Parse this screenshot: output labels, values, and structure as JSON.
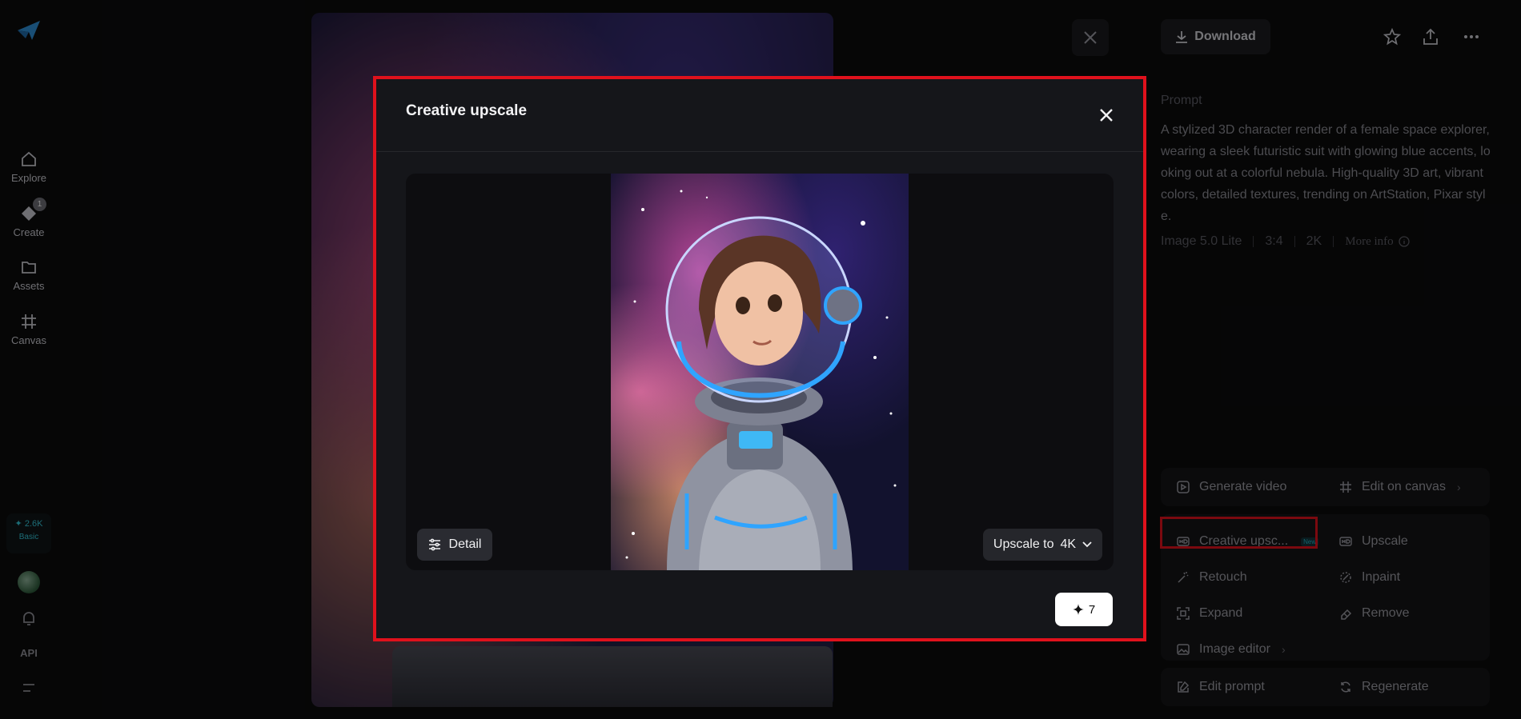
{
  "sidebar": {
    "items": [
      {
        "label": "Explore",
        "icon": "home-icon"
      },
      {
        "label": "Create",
        "icon": "create-icon",
        "badge": "1"
      },
      {
        "label": "Assets",
        "icon": "folder-icon"
      },
      {
        "label": "Canvas",
        "icon": "canvas-icon"
      }
    ],
    "credits": {
      "amount": "✦ 2.6K",
      "plan": "Basic"
    },
    "api_label": "API"
  },
  "right_panel": {
    "download_label": "Download",
    "prompt_label": "Prompt",
    "prompt_text": "A stylized 3D character render of a female space explorer, wearing a sleek futuristic suit with glowing blue accents, looking out at a colorful nebula. High-quality 3D art, vibrant colors, detailed textures, trending on ArtStation, Pixar style.",
    "meta": {
      "model": "Image 5.0 Lite",
      "ratio": "3:4",
      "resolution": "2K",
      "more_info": "More info"
    },
    "actions": {
      "generate_video": "Generate video",
      "edit_on_canvas": "Edit on canvas",
      "creative_upscale": "Creative upsc...",
      "creative_upscale_tag": "New",
      "upscale": "Upscale",
      "retouch": "Retouch",
      "inpaint": "Inpaint",
      "expand": "Expand",
      "remove": "Remove",
      "image_editor": "Image editor",
      "edit_prompt": "Edit prompt",
      "regenerate": "Regenerate"
    }
  },
  "modal": {
    "title": "Creative upscale",
    "detail_label": "Detail",
    "upscale_prefix": "Upscale to",
    "upscale_value": "4K",
    "credit_cost": "7"
  },
  "colors": {
    "highlight": "#e0111c",
    "accent": "#34c6d9"
  }
}
